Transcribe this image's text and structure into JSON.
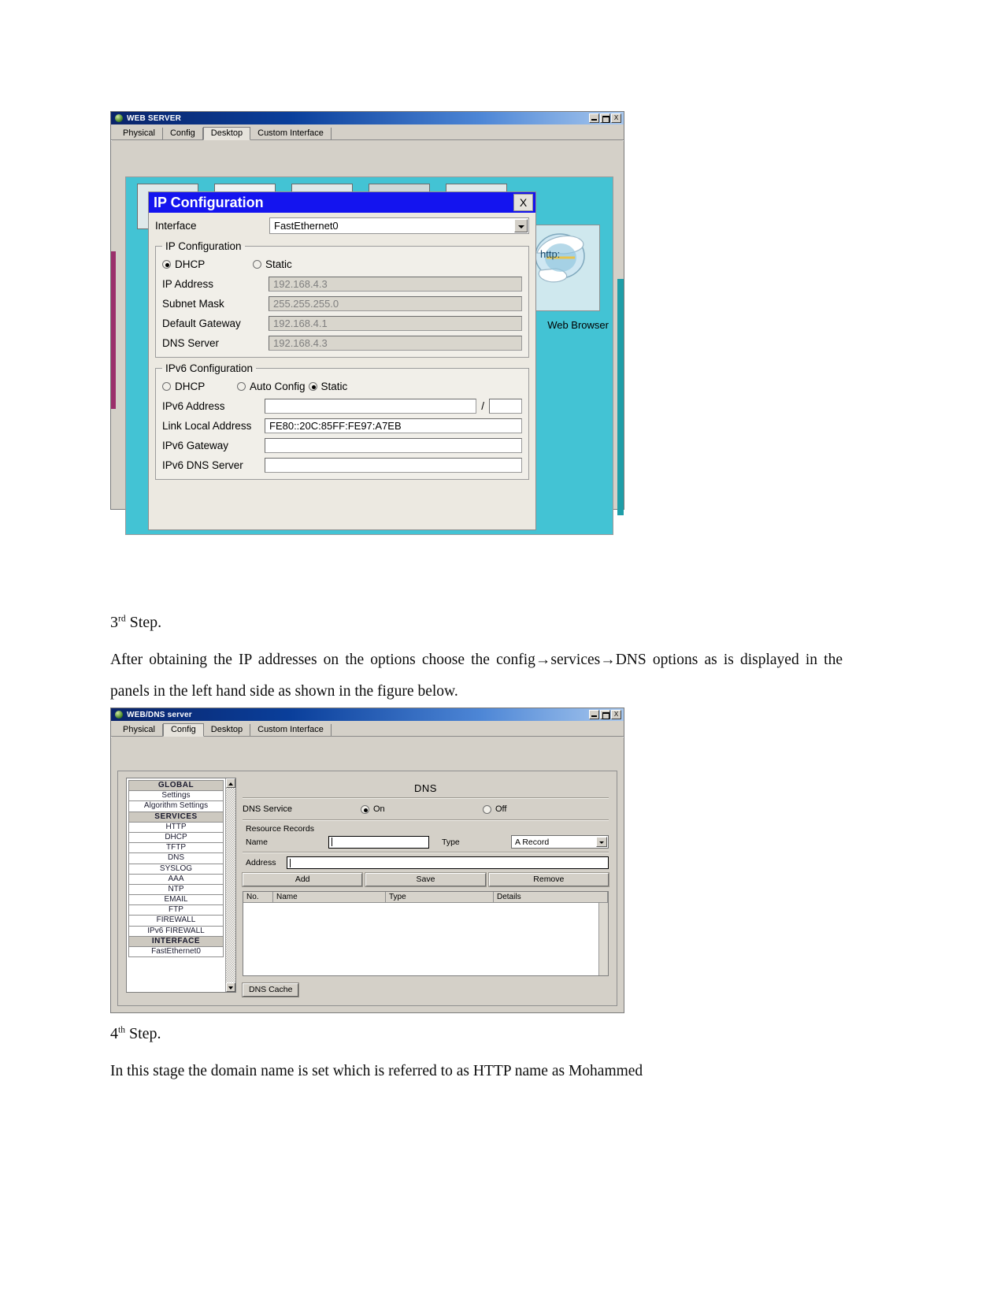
{
  "document": {
    "step3": {
      "num": "3",
      "sup": "rd",
      "word": " Step."
    },
    "step3_para": "After obtaining the IP addresses on the options choose the config→services→DNS options as is displayed in the panels in the left hand side as shown in the figure below.",
    "step4": {
      "num": "4",
      "sup": "th",
      "word": " Step."
    },
    "step4_para": "In this stage the domain name is set which is referred to as HTTP name as Mohammed"
  },
  "figure1": {
    "window_title": "WEB SERVER",
    "title_icon": "packet-tracer-device-icon",
    "window_buttons": {
      "minimize": "_",
      "maximize": "□",
      "close": "X"
    },
    "tabs": [
      {
        "label": "Physical",
        "active": false
      },
      {
        "label": "Config",
        "active": false
      },
      {
        "label": "Desktop",
        "active": true
      },
      {
        "label": "Custom Interface",
        "active": false
      }
    ],
    "desktop": {
      "browser_icon": "internet-explorer-icon",
      "browser_icon_text": "http:",
      "web_browser_label": "Web Browser"
    },
    "dialog": {
      "title": "IP Configuration",
      "close_label": "X",
      "interface_label": "Interface",
      "interface_value": "FastEthernet0",
      "ipv4": {
        "group_label": "IP Configuration",
        "dhcp_label": "DHCP",
        "dhcp_selected": true,
        "static_label": "Static",
        "static_selected": false,
        "fields": [
          {
            "label": "IP Address",
            "value": "192.168.4.3"
          },
          {
            "label": "Subnet Mask",
            "value": "255.255.255.0"
          },
          {
            "label": "Default Gateway",
            "value": "192.168.4.1"
          },
          {
            "label": "DNS Server",
            "value": "192.168.4.3"
          }
        ]
      },
      "ipv6": {
        "group_label": "IPv6 Configuration",
        "dhcp_label": "DHCP",
        "dhcp_selected": false,
        "auto_config_label": "Auto Config",
        "auto_config_selected": false,
        "static_label": "Static",
        "static_selected": true,
        "address_label": "IPv6 Address",
        "address_value": "",
        "prefix_separator": "/",
        "prefix_value": "",
        "link_local_label": "Link Local Address",
        "link_local_value": "FE80::20C:85FF:FE97:A7EB",
        "gateway_label": "IPv6 Gateway",
        "gateway_value": "",
        "dns_label": "IPv6 DNS Server",
        "dns_value": ""
      }
    }
  },
  "figure2": {
    "window_title": "WEB/DNS server",
    "title_icon": "packet-tracer-device-icon",
    "window_buttons": {
      "minimize": "_",
      "maximize": "□",
      "close": "X"
    },
    "tabs": [
      {
        "label": "Physical",
        "active": false
      },
      {
        "label": "Config",
        "active": true
      },
      {
        "label": "Desktop",
        "active": false
      },
      {
        "label": "Custom Interface",
        "active": false
      }
    ],
    "sidebar": {
      "items": [
        {
          "label": "GLOBAL",
          "header": true
        },
        {
          "label": "Settings",
          "header": false
        },
        {
          "label": "Algorithm Settings",
          "header": false
        },
        {
          "label": "SERVICES",
          "header": true
        },
        {
          "label": "HTTP",
          "header": false
        },
        {
          "label": "DHCP",
          "header": false
        },
        {
          "label": "TFTP",
          "header": false
        },
        {
          "label": "DNS",
          "header": false
        },
        {
          "label": "SYSLOG",
          "header": false
        },
        {
          "label": "AAA",
          "header": false
        },
        {
          "label": "NTP",
          "header": false
        },
        {
          "label": "EMAIL",
          "header": false
        },
        {
          "label": "FTP",
          "header": false
        },
        {
          "label": "FIREWALL",
          "header": false
        },
        {
          "label": "IPv6 FIREWALL",
          "header": false
        },
        {
          "label": "INTERFACE",
          "header": true
        },
        {
          "label": "FastEthernet0",
          "header": false
        }
      ]
    },
    "dns_panel": {
      "heading": "DNS",
      "service_label": "DNS Service",
      "on_label": "On",
      "on_selected": true,
      "off_label": "Off",
      "off_selected": false,
      "resource_records_label": "Resource Records",
      "name_label": "Name",
      "name_value": "",
      "type_label": "Type",
      "type_value": "A Record",
      "address_label": "Address",
      "address_value": "",
      "buttons": {
        "add": "Add",
        "save": "Save",
        "remove": "Remove"
      },
      "table_headers": [
        "No.",
        "Name",
        "Type",
        "Details"
      ],
      "table_rows": [],
      "dns_cache_button": "DNS Cache"
    }
  }
}
